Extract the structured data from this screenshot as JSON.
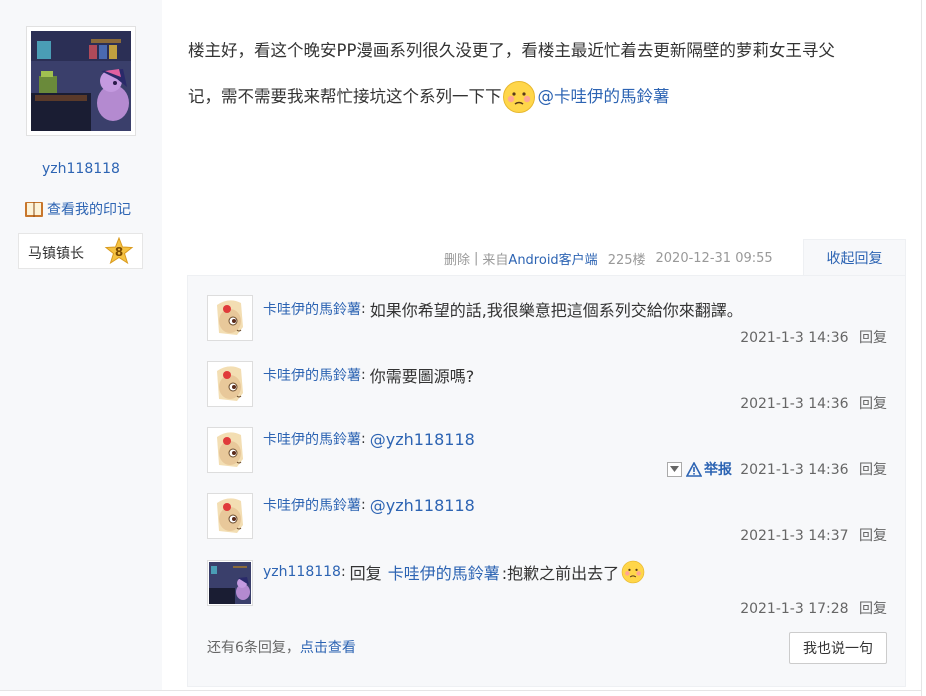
{
  "author": {
    "username": "yzh118118",
    "imprint_link": "查看我的印记",
    "level_title": "马镇镇长",
    "level_number": "8"
  },
  "post": {
    "text_line1": "楼主好，看这个晚安PP漫画系列很久没更了，看楼主最近忙着去更新隔壁的萝莉女王寻父",
    "text_line2": "记，需不需要我来帮忙接坑这个系列一下下",
    "mention": "@卡哇伊的馬鈴薯",
    "meta": {
      "delete": "删除",
      "separator": "|",
      "from_prefix": "来自",
      "client": "Android客户端",
      "floor": "225楼",
      "datetime": "2020-12-31 09:55"
    },
    "collapse_label": "收起回复"
  },
  "replies": [
    {
      "author": "卡哇伊的馬鈴薯",
      "colon": ":",
      "text": "如果你希望的話,我很樂意把這個系列交給你來翻譯。",
      "time": "2021-1-3 14:36",
      "reply_label": "回复"
    },
    {
      "author": "卡哇伊的馬鈴薯",
      "colon": ":",
      "text": "你需要圖源嗎?",
      "time": "2021-1-3 14:36",
      "reply_label": "回复"
    },
    {
      "author": "卡哇伊的馬鈴薯",
      "colon": ":",
      "mention": "@yzh118118",
      "report_label": "举报",
      "time": "2021-1-3 14:36",
      "reply_label": "回复"
    },
    {
      "author": "卡哇伊的馬鈴薯",
      "colon": ":",
      "mention": "@yzh118118",
      "time": "2021-1-3 14:37",
      "reply_label": "回复"
    },
    {
      "author": "yzh118118",
      "colon": ":",
      "reply_prefix": "回复",
      "reply_target": "卡哇伊的馬鈴薯",
      "text": ":抱歉之前出去了",
      "time": "2021-1-3 17:28",
      "reply_label": "回复"
    }
  ],
  "footer": {
    "more_text": "还有6条回复，",
    "view_link": "点击查看",
    "say_button": "我也说一句"
  },
  "colors": {
    "link": "#2d64b3",
    "panel_bg": "#f7f8fa",
    "meta_gray": "#999999"
  }
}
